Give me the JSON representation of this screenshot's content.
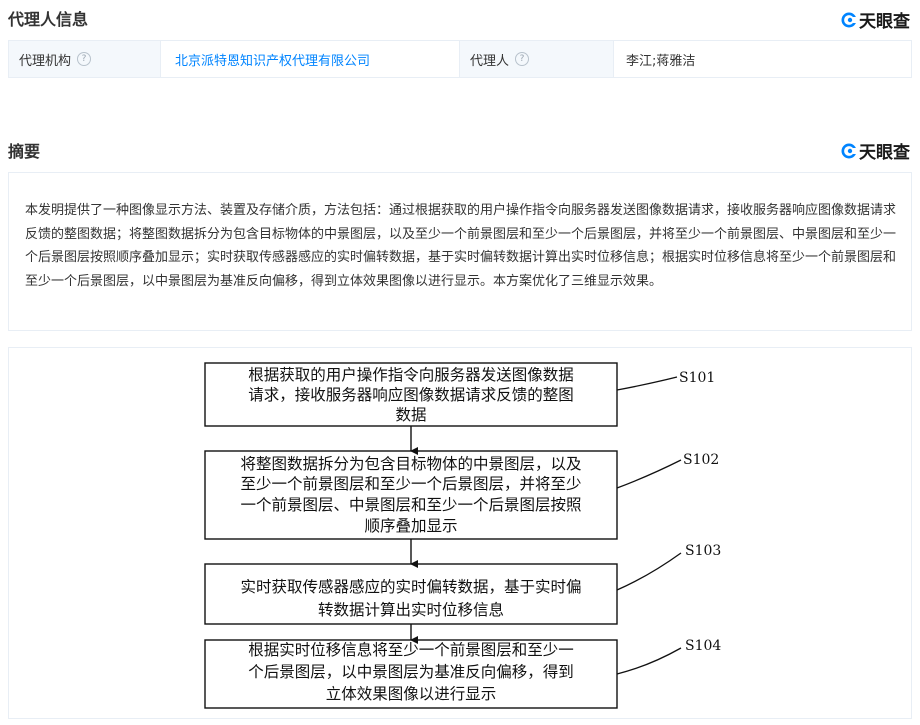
{
  "agent_section": {
    "title": "代理人信息",
    "brand": "天眼查",
    "agency_label": "代理机构",
    "agency_value": "北京派特恩知识产权代理有限公司",
    "agent_label": "代理人",
    "agent_value": "李江;蒋雅洁",
    "help_glyph": "?"
  },
  "abstract_section": {
    "title": "摘要",
    "brand": "天眼查",
    "text": "本发明提供了一种图像显示方法、装置及存储介质，方法包括：通过根据获取的用户操作指令向服务器发送图像数据请求，接收服务器响应图像数据请求反馈的整图数据；将整图数据拆分为包含目标物体的中景图层，以及至少一个前景图层和至少一个后景图层，并将至少一个前景图层、中景图层和至少一个后景图层按照顺序叠加显示；实时获取传感器感应的实时偏转数据，基于实时偏转数据计算出实时位移信息；根据实时位移信息将至少一个前景图层和至少一个后景图层，以中景图层为基准反向偏移，得到立体效果图像以进行显示。本方案优化了三维显示效果。"
  },
  "flowchart": {
    "steps": [
      {
        "id": "S101",
        "lines": [
          "根据获取的用户操作指令向服务器发送图像数据",
          "请求，接收服务器响应图像数据请求反馈的整图",
          "数据"
        ]
      },
      {
        "id": "S102",
        "lines": [
          "将整图数据拆分为包含目标物体的中景图层，以及",
          "至少一个前景图层和至少一个后景图层，并将至少",
          "一个前景图层、中景图层和至少一个后景图层按照",
          "顺序叠加显示"
        ]
      },
      {
        "id": "S103",
        "lines": [
          "实时获取传感器感应的实时偏转数据，基于实时偏",
          "转数据计算出实时位移信息"
        ]
      },
      {
        "id": "S104",
        "lines": [
          "根据实时位移信息将至少一个前景图层和至少一",
          "个后景图层，以中景图层为基准反向偏移，得到",
          "立体效果图像以进行显示"
        ]
      }
    ]
  }
}
